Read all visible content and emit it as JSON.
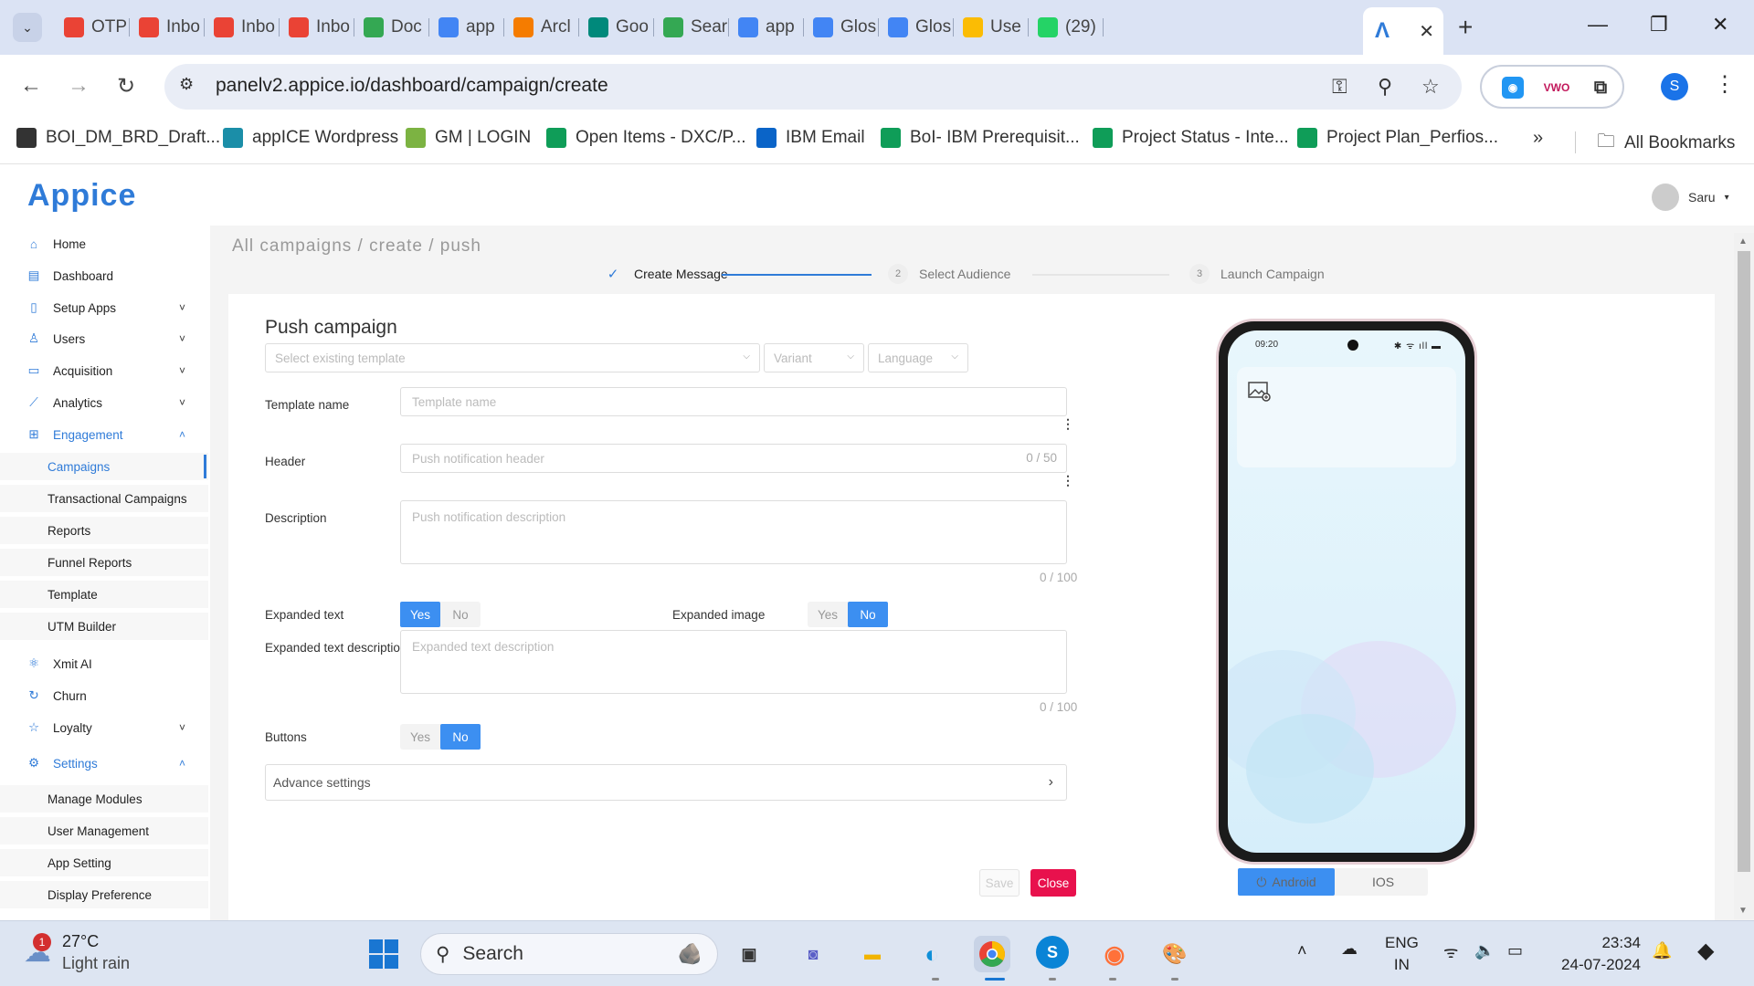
{
  "browser": {
    "tabs": [
      {
        "label": "OTP",
        "icon": "gmail-icon",
        "color": "#ea4335"
      },
      {
        "label": "Inbo",
        "icon": "gmail-icon",
        "color": "#ea4335"
      },
      {
        "label": "Inbo",
        "icon": "gmail-icon",
        "color": "#ea4335"
      },
      {
        "label": "Inbo",
        "icon": "gmail-icon",
        "color": "#ea4335"
      },
      {
        "label": "Doc",
        "icon": "google-drive-icon",
        "color": "#34a853"
      },
      {
        "label": "app",
        "icon": "google-docs-icon",
        "color": "#4285f4"
      },
      {
        "label": "Arcl",
        "icon": "archive-icon",
        "color": "#f57c00"
      },
      {
        "label": "Goo",
        "icon": "google-meet-icon",
        "color": "#00897b"
      },
      {
        "label": "Sear",
        "icon": "google-drive-icon",
        "color": "#34a853"
      },
      {
        "label": "app",
        "icon": "google-docs-icon",
        "color": "#4285f4"
      },
      {
        "label": "Glos",
        "icon": "google-docs-icon",
        "color": "#4285f4"
      },
      {
        "label": "Glos",
        "icon": "google-docs-icon",
        "color": "#4285f4"
      },
      {
        "label": "Use",
        "icon": "google-ads-icon",
        "color": "#fbbc04"
      },
      {
        "label": "(29)",
        "icon": "whatsapp-icon",
        "color": "#25d366"
      }
    ],
    "active_tab_icon": "appice-icon",
    "url": "panelv2.appice.io/dashboard/campaign/create",
    "profile_initial": "S",
    "bookmarks": [
      {
        "label": "BOI_DM_BRD_Draft...",
        "icon": "github-icon",
        "color": "#333333"
      },
      {
        "label": "appICE Wordpress",
        "icon": "appice-icon",
        "color": "#1b8ea8"
      },
      {
        "label": "GM | LOGIN",
        "icon": "leaf-icon",
        "color": "#7cb342"
      },
      {
        "label": "Open Items - DXC/P...",
        "icon": "google-sheets-icon",
        "color": "#0f9d58"
      },
      {
        "label": "IBM Email",
        "icon": "outlook-icon",
        "color": "#0a64c8"
      },
      {
        "label": "BoI- IBM Prerequisit...",
        "icon": "google-sheets-icon",
        "color": "#0f9d58"
      },
      {
        "label": "Project Status - Inte...",
        "icon": "google-sheets-icon",
        "color": "#0f9d58"
      },
      {
        "label": "Project Plan_Perfios...",
        "icon": "google-sheets-icon",
        "color": "#0f9d58"
      }
    ],
    "all_bookmarks": "All Bookmarks"
  },
  "app": {
    "logo": "Appice",
    "user": "Saru",
    "accent": "#2f7bd8",
    "nav": [
      {
        "label": "Home",
        "icon": "home-icon"
      },
      {
        "label": "Dashboard",
        "icon": "dashboard-icon"
      },
      {
        "label": "Setup Apps",
        "icon": "setup-apps-icon",
        "chevron": "down"
      },
      {
        "label": "Users",
        "icon": "users-icon",
        "chevron": "down"
      },
      {
        "label": "Acquisition",
        "icon": "acquisition-icon",
        "chevron": "down"
      },
      {
        "label": "Analytics",
        "icon": "analytics-icon",
        "chevron": "down"
      },
      {
        "label": "Engagement",
        "icon": "engagement-icon",
        "chevron": "up"
      }
    ],
    "engagement_sub": [
      "Campaigns",
      "Transactional Campaigns",
      "Reports",
      "Funnel Reports",
      "Template",
      "UTM Builder"
    ],
    "nav2": [
      {
        "label": "Xmit AI",
        "icon": "xmit-ai-icon"
      },
      {
        "label": "Churn",
        "icon": "churn-icon"
      },
      {
        "label": "Loyalty",
        "icon": "loyalty-icon",
        "chevron": "down"
      },
      {
        "label": "Settings",
        "icon": "settings-icon",
        "chevron": "up"
      }
    ],
    "settings_sub": [
      "Manage Modules",
      "User Management",
      "App Setting",
      "Display Preference"
    ]
  },
  "main": {
    "breadcrumb": "All campaigns / create / push",
    "steps": [
      {
        "num": "✓",
        "label": "Create Message"
      },
      {
        "num": "2",
        "label": "Select Audience"
      },
      {
        "num": "3",
        "label": "Launch Campaign"
      }
    ],
    "form": {
      "title": "Push campaign",
      "template_select_placeholder": "Select existing template",
      "variant_placeholder": "Variant",
      "language_placeholder": "Language",
      "template_name_label": "Template name",
      "template_name_placeholder": "Template name",
      "header_label": "Header",
      "header_placeholder": "Push notification header",
      "header_counter": "0 / 50",
      "description_label": "Description",
      "description_placeholder": "Push notification description",
      "description_counter": "0 / 100",
      "expanded_text_label": "Expanded text",
      "expanded_image_label": "Expanded image",
      "expanded_text_desc_label": "Expanded text description",
      "expanded_text_desc_placeholder": "Expanded text description",
      "expanded_text_desc_counter": "0 / 100",
      "buttons_label": "Buttons",
      "yes": "Yes",
      "no": "No",
      "advance_settings": "Advance settings",
      "save": "Save",
      "close": "Close"
    },
    "preview": {
      "time": "09:20",
      "status_icons": "✱ ᯤ ıll ▬",
      "android": "Android",
      "ios": "IOS"
    }
  },
  "taskbar": {
    "weather_temp": "27°C",
    "weather_desc": "Light rain",
    "weather_badge": "1",
    "search": "Search",
    "lang_top": "ENG",
    "lang_bottom": "IN",
    "time": "23:34",
    "date": "24-07-2024"
  }
}
